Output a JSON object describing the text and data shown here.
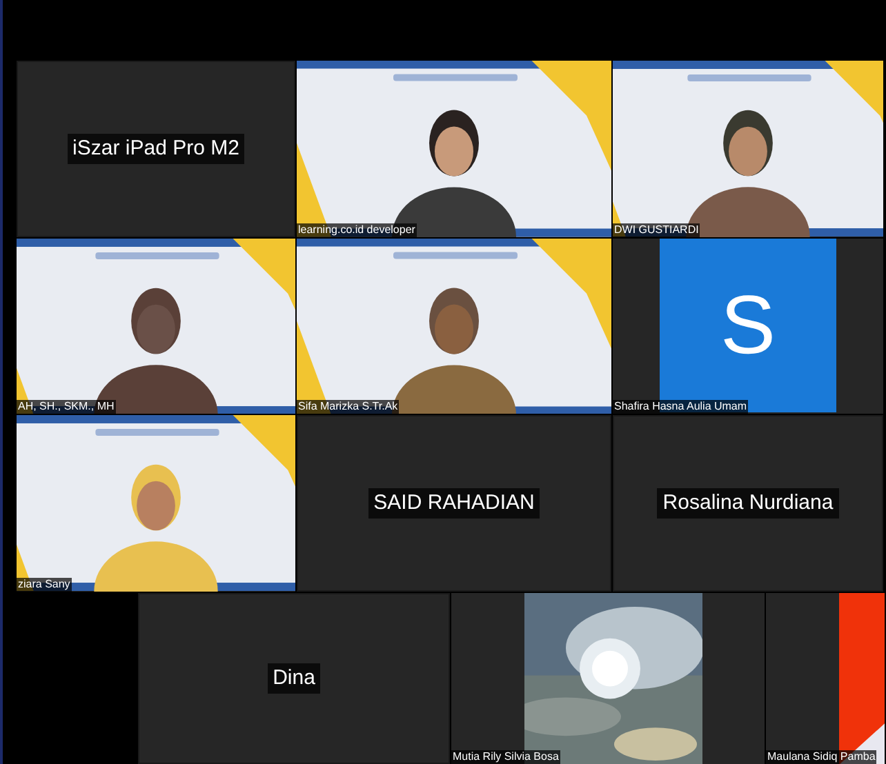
{
  "rows": [
    {
      "tiles": [
        {
          "kind": "name_only",
          "name": "iSzar iPad Pro M2"
        },
        {
          "kind": "video",
          "name": "learning.co.id developer"
        },
        {
          "kind": "video",
          "name": "DWI GUSTIARDI"
        }
      ]
    },
    {
      "tiles": [
        {
          "kind": "video",
          "name": "AH, SH., SKM., MH"
        },
        {
          "kind": "video",
          "name": "Sifa Marizka S.Tr.Ak"
        },
        {
          "kind": "avatar",
          "initial": "S",
          "name": "Shafira Hasna Aulia Umam"
        }
      ]
    },
    {
      "tiles": [
        {
          "kind": "video",
          "name": "ziara Sany"
        },
        {
          "kind": "name_only",
          "name": "SAID RAHADIAN"
        },
        {
          "kind": "name_only",
          "name": "Rosalina Nurdiana"
        }
      ]
    },
    {
      "tiles": [
        {
          "kind": "blank"
        },
        {
          "kind": "name_only",
          "name": "Dina"
        },
        {
          "kind": "video_sky",
          "name": "Mutia Rily Silvia Bosa"
        },
        {
          "kind": "video_red",
          "name": "Maulana Sidiq Pamba"
        }
      ]
    }
  ]
}
